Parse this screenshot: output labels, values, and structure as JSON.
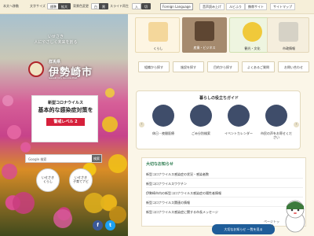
{
  "topbar": {
    "skip_link": "本文へ移動",
    "font_size_label": "文字サイズ",
    "font_std": "標準",
    "font_large": "拡大",
    "bg_color_label": "背景色変更",
    "bg_white": "白",
    "bg_black": "黒",
    "slide_label": "スライド再生",
    "slide_on": "入",
    "slide_off": "切",
    "language": "Foreign Language",
    "voice": "音声読み上げ",
    "furigana": "ルビふり",
    "mobile": "携帯サイト",
    "sitemap": "サイトマップ"
  },
  "hero": {
    "tagline_1": "いせさき",
    "tagline_2": "人にやさしく未来を創る",
    "pref": "群馬県",
    "city": "伊勢崎市",
    "roman": "Isesaki City Gunma Pref."
  },
  "covid": {
    "line1": "新型コロナウイルス",
    "line2": "基本的な感染症対策を",
    "level": "警戒レベル 2"
  },
  "search": {
    "label": "Google 検索",
    "button": "検索"
  },
  "bubbles": {
    "left": "いせさき\nくらし",
    "right": "いせさき\n子育てナビ"
  },
  "tiles": [
    {
      "label": "くらし",
      "color": "#f4d79b"
    },
    {
      "label": "産業・ビジネス",
      "color": "#a58a6e"
    },
    {
      "label": "観光・文化",
      "color": "#c8dfae"
    },
    {
      "label": "市政情報",
      "color": "#e9e0c8"
    }
  ],
  "small_tiles": [
    "組織から探す",
    "施設を探す",
    "目的から探す",
    "よくあるご質問",
    "お問い合わせ"
  ],
  "guide": {
    "title": "暮らしの役立ちガイド",
    "items": [
      "休日・夜間医療",
      "ごみ分別検索",
      "イベントカレンダー",
      "市民の声をお寄せください"
    ]
  },
  "news": {
    "heading": "大切なお知らせ",
    "items": [
      "新型コロナウイルス感染症の状況・感染者数",
      "新型コロナウイルスワクチン",
      "伊勢崎市内の新型コロナウイルス感染症の陽性者情報",
      "新型コロナウイルス関連の情報",
      "新型コロナウイルス感染症に関する市長メッセージ"
    ]
  },
  "footer": {
    "translate_bar": "大切なお知らせ 一覧を見る",
    "to_top": "ページトップ"
  },
  "sns": {
    "facebook": "f",
    "twitter": "t"
  }
}
